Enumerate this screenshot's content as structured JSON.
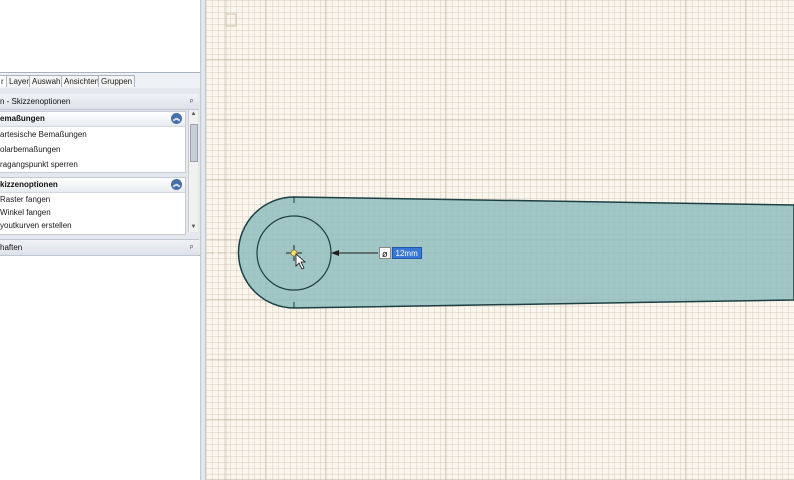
{
  "tabs": [
    {
      "label": "r",
      "active": true
    },
    {
      "label": "Layer",
      "active": false
    },
    {
      "label": "Auswahl",
      "active": false
    },
    {
      "label": "Ansichten",
      "active": false
    },
    {
      "label": "Gruppen",
      "active": false
    }
  ],
  "sketch_options_panel": {
    "title": "n - Skizzenoptionen",
    "groups": [
      {
        "title": "emaßungen",
        "items": [
          "artesische Bemaßungen",
          "olarbemaßungen",
          "ragangspunkt sperren"
        ]
      },
      {
        "title": "kizzenoptionen",
        "items": [
          "Raster fangen",
          "Winkel fangen",
          "youtkurven erstellen"
        ]
      }
    ]
  },
  "properties_panel": {
    "title": "haften"
  },
  "dimension_input": {
    "symbol": "ø",
    "value": "12mm"
  },
  "colors": {
    "part_fill": "#8fbdbe",
    "part_stroke": "#1d3f42",
    "highlight": "#3a78d8"
  }
}
